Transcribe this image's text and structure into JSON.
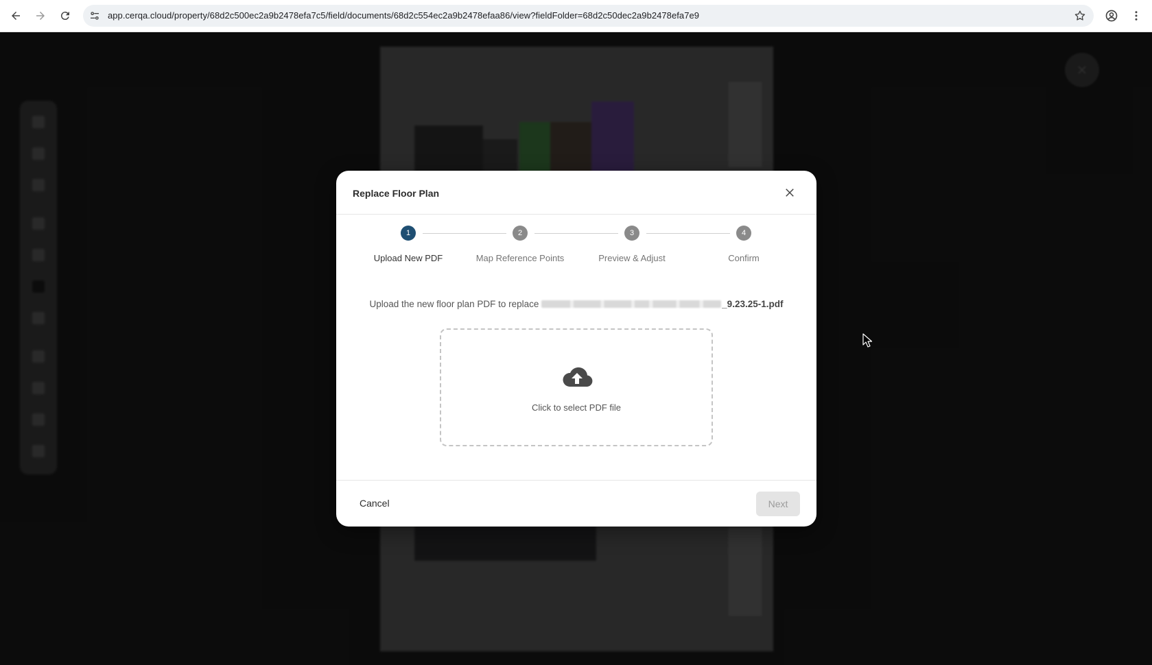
{
  "browser": {
    "url": "app.cerqa.cloud/property/68d2c500ec2a9b2478efa7c5/field/documents/68d2c554ec2a9b2478efaa86/view?fieldFolder=68d2c50dec2a9b2478efa7e9",
    "icons": [
      "back-arrow-icon",
      "forward-arrow-icon",
      "reload-icon",
      "site-info-icon",
      "star-icon",
      "profile-icon",
      "more-vert-icon"
    ]
  },
  "modal": {
    "title": "Replace Floor Plan",
    "steps": [
      {
        "number": "1",
        "label": "Upload New PDF",
        "state": "active"
      },
      {
        "number": "2",
        "label": "Map Reference Points",
        "state": "inactive"
      },
      {
        "number": "3",
        "label": "Preview & Adjust",
        "state": "inactive"
      },
      {
        "number": "4",
        "label": "Confirm",
        "state": "inactive"
      }
    ],
    "description_prefix": "Upload the new floor plan PDF to replace",
    "file_name_visible": "_9.23.25-1.pdf",
    "dropzone_label": "Click to select PDF file",
    "cancel_label": "Cancel",
    "next_label": "Next",
    "next_enabled": false
  },
  "colors": {
    "step_active": "#1f4f73",
    "step_inactive": "#8a8a8a",
    "overlay": "rgba(0,0,0,0.55)"
  }
}
